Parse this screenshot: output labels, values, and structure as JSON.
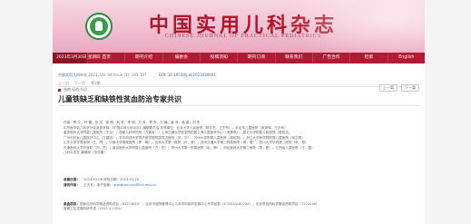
{
  "header": {
    "title_cn": "中国实用儿科杂志",
    "title_en": "CHINESE JOURNAL OF PRACTICAL PEDIATRICS"
  },
  "nav": {
    "date": "2023年3月30日 星期四",
    "items": [
      "首页",
      "期刊介绍",
      "编委会",
      "投稿须知",
      "期刊订阅",
      "联系我们",
      "广告合作",
      "检索",
      "English"
    ]
  },
  "meta": {
    "journal_cite": "中国实用儿科杂志",
    "cite_detail": "2023, Vol. 38 Issue (3): 161-167",
    "doi_label": "DOI:",
    "doi_value": "10.19538/j.ek2023030601",
    "pager": [
      "上一页",
      "下一页",
      "第3期"
    ],
    "tag": "指南·标准·共识",
    "prev": "上一篇",
    "next": "下一篇"
  },
  "article": {
    "title": "儿童铁缺乏和缺铁性贫血防治专家共识"
  },
  "authors": {
    "lines": [
      "作者：杨 文，叶 雷，孙 洋，徐 丽，刘 芳，李 明，方 芳，郑 杰，方 楠，吴 萍，吴 淑，刘 杰",
      "中华医学会儿科学分会血液学组 《中国实用儿科杂志》编辑委员会 执笔单位：北京大学人民医院（杨文杰，王天有）；北京市儿童医院（吴润晖，王天有）",
      "重庆医科大学附属儿童医院（于洁）；首都儿科研究所（方拥军）；上海交通大学医学院附属上海儿童医学中心（汤静燕）；复旦大学附属儿科医院（翟晓文）",
      "广州市妇女儿童医疗中心（方建培）；华中科技大学同济医学院附属同济医院（孙，华）；苏州大学附属儿童医院（胡绍燕）；浙江大学医学院附属儿童医院（徐卫群）",
      "山东大学齐鲁医院（王，明）；中南大学湘雅医院（罗，楠）；吉林大学第一医院（孙，莹）；西安交通大学第二附属医院（吴，雪）；四川大学华西第二医院（朱，易）",
      "天津医科大学总医院（刘，杰）；南京医科大学附属儿童医院（方，芳）；郑州大学第一附属医院（赵，静）；河北医科大学第二医院（李，刚）；江西省儿童医院（王，磊）",
      "儿科杂志社 编辑部（张洪雷）"
    ]
  },
  "info": {
    "dates_label": "收稿日期：",
    "dates_value": "2023-03-06  修回日期：2023-03-28",
    "corr_label": "通讯作者：",
    "corr_value": "王天有，电子信箱：",
    "email": "wangtianyou@bch.edu.cn"
  },
  "funding": {
    "label": "基金项目：",
    "lines": [
      "国家自然科学基金资助项目（82273645）；北京市医院管理中心儿科学科协同发展中心专项经费（XTZD20180204）；北京市自然科学基金资助项目（7222046）",
      "首都卫生发展科研专项（2022-2-2104）"
    ]
  }
}
